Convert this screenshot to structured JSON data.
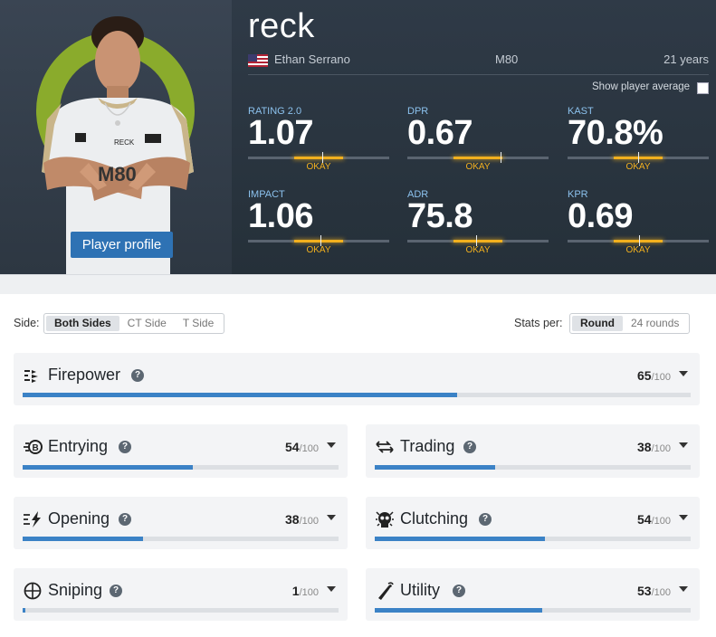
{
  "player": {
    "nickname": "reck",
    "real_name": "Ethan Serrano",
    "country": "United States",
    "team": "M80",
    "age": "21 years",
    "profile_button": "Player profile"
  },
  "show_average_label": "Show player average",
  "stats": [
    {
      "label": "RATING 2.0",
      "value": "1.07",
      "grade": "OKAY"
    },
    {
      "label": "DPR",
      "value": "0.67",
      "grade": "OKAY"
    },
    {
      "label": "KAST",
      "value": "70.8%",
      "grade": "OKAY"
    },
    {
      "label": "IMPACT",
      "value": "1.06",
      "grade": "OKAY"
    },
    {
      "label": "ADR",
      "value": "75.8",
      "grade": "OKAY"
    },
    {
      "label": "KPR",
      "value": "0.69",
      "grade": "OKAY"
    }
  ],
  "side": {
    "label": "Side:",
    "options": [
      "Both Sides",
      "CT Side",
      "T Side"
    ],
    "selected": "Both Sides"
  },
  "stats_per": {
    "label": "Stats per:",
    "options": [
      "Round",
      "24 rounds"
    ],
    "selected": "Round"
  },
  "categories": [
    {
      "name": "Firepower",
      "score": "65",
      "max": "/100",
      "icon": "firepower-icon"
    },
    {
      "name": "Entrying",
      "score": "54",
      "max": "/100",
      "icon": "entrying-icon"
    },
    {
      "name": "Trading",
      "score": "38",
      "max": "/100",
      "icon": "trading-icon"
    },
    {
      "name": "Opening",
      "score": "38",
      "max": "/100",
      "icon": "opening-icon"
    },
    {
      "name": "Clutching",
      "score": "54",
      "max": "/100",
      "icon": "clutching-icon"
    },
    {
      "name": "Sniping",
      "score": "1",
      "max": "/100",
      "icon": "crosshair-icon"
    },
    {
      "name": "Utility",
      "score": "53",
      "max": "/100",
      "icon": "utility-icon"
    }
  ],
  "colors": {
    "accent": "#3b82c6",
    "okay": "#f2b01e",
    "header_bg": "#2f3a47",
    "logo_green": "#8aab2c"
  }
}
